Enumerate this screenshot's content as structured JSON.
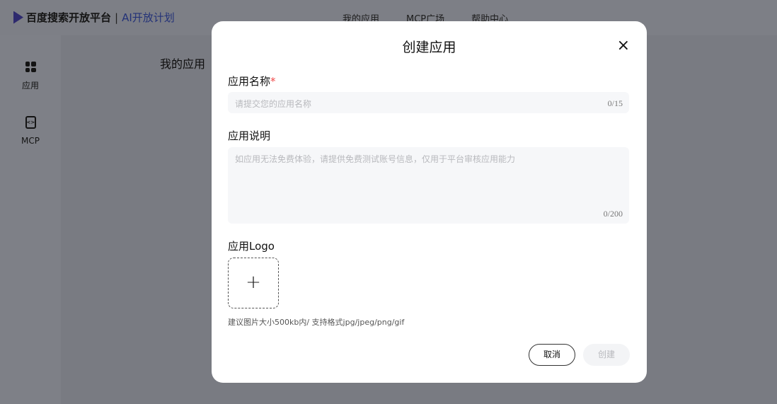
{
  "header": {
    "brand": "百度搜索开放平台",
    "separator": "|",
    "brand_sub": "AI开放计划",
    "nav": [
      "我的应用",
      "MCP广场",
      "帮助中心"
    ]
  },
  "sidebar": {
    "items": [
      {
        "label": "应用",
        "icon": "grid-icon"
      },
      {
        "label": "MCP",
        "icon": "code-file-icon"
      }
    ]
  },
  "main": {
    "title": "我的应用"
  },
  "modal": {
    "title": "创建应用",
    "name_label": "应用名称",
    "required_mark": "*",
    "name_placeholder": "请提交您的应用名称",
    "name_count": "0/15",
    "desc_label": "应用说明",
    "desc_placeholder": "如应用无法免费体验，请提供免费测试账号信息，仅用于平台审核应用能力",
    "desc_count": "0/200",
    "logo_label": "应用Logo",
    "upload_icon": "+",
    "logo_hint": "建议图片大小500kb内/ 支持格式jpg/jpeg/png/gif",
    "cancel": "取消",
    "create": "创建",
    "close": "×"
  }
}
